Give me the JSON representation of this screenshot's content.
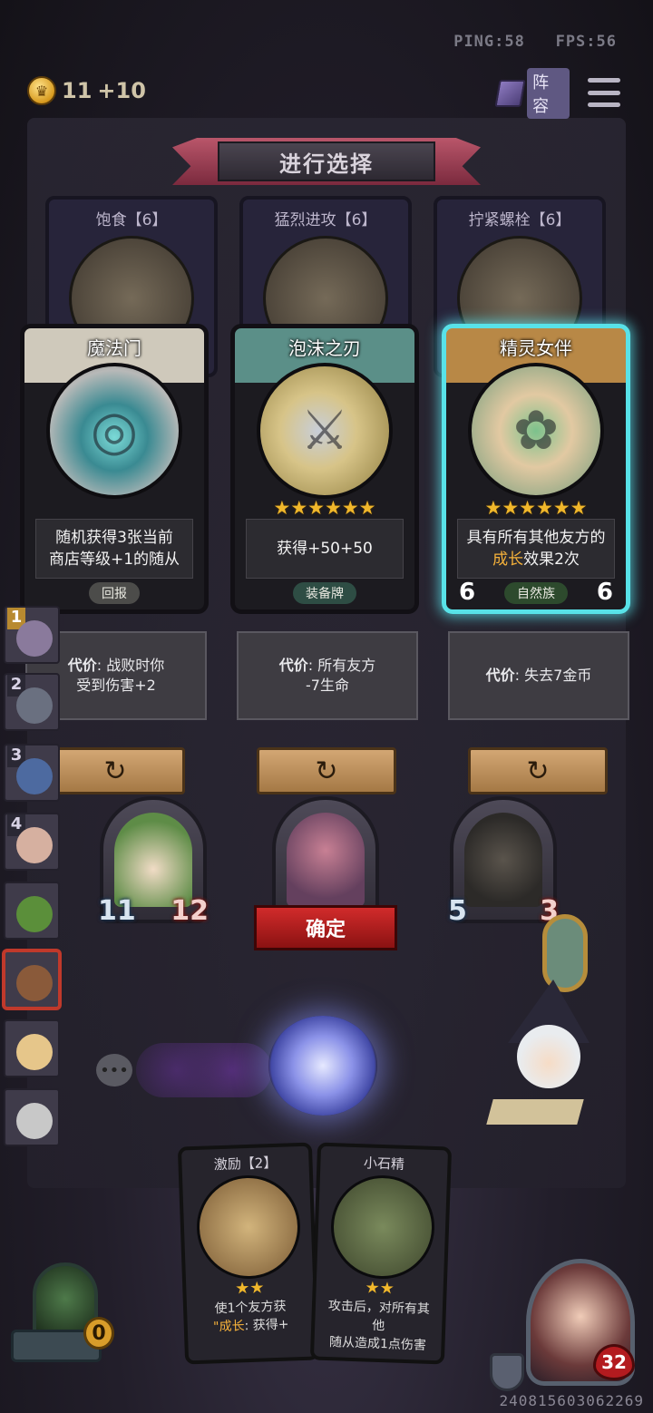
{
  "hud": {
    "ping": "PING:58",
    "fps": "FPS:56",
    "coins": "11",
    "coin_bonus": "+10",
    "lineup_label": "阵容"
  },
  "banner": {
    "title": "进行选择"
  },
  "back_cards": [
    {
      "title": "饱食【6】"
    },
    {
      "title": "猛烈进攻【6】"
    },
    {
      "title": "拧紧螺栓【6】"
    }
  ],
  "choices": [
    {
      "title": "魔法门",
      "desc_line1": "随机获得3张当前",
      "desc_line2": "商店等级+1的随从",
      "tag": "回报",
      "stars": "",
      "cost_label": "代价",
      "cost_line1": ": 战败时你",
      "cost_line2": "受到伤害+2"
    },
    {
      "title": "泡沫之刃",
      "desc_line1": "获得+50+50",
      "desc_line2": "",
      "tag": "装备牌",
      "stars": "★★★★★★",
      "cost_label": "代价",
      "cost_line1": ": 所有友方",
      "cost_line2": "-7生命"
    },
    {
      "title": "精灵女伴",
      "desc_line1": "具有所有其他友方的",
      "desc_hl": "成长",
      "desc_line2_rest": "效果2次",
      "tag": "自然族",
      "stars": "★★★★★★",
      "attack": "6",
      "health": "6",
      "cost_label": "代价",
      "cost_line1": ": 失去7金币",
      "cost_line2": ""
    }
  ],
  "shop_minions": [
    {
      "attack": "11",
      "health": "12"
    },
    {
      "attack": "",
      "health": ""
    },
    {
      "attack": "5",
      "health": "3"
    }
  ],
  "confirm_label": "确定",
  "tiers": [
    "1",
    "2",
    "3",
    "4"
  ],
  "hand": [
    {
      "title": "激励【2】",
      "stars": "★★",
      "desc_line1": "使1个友方获",
      "desc_hl": "\"成长",
      "desc_line2_rest": ": 获得+"
    },
    {
      "title": "小石精",
      "stars": "★★",
      "desc_line1": "攻击后，对所有其他",
      "desc_line2": "随从造成1点伤害"
    }
  ],
  "portal_count": "0",
  "hero_hp": "32",
  "user_id": "240815603062269",
  "icons": {
    "coin": "coin-icon",
    "lineup": "book-icon",
    "menu": "hamburger-menu-icon",
    "refresh": "refresh-arrow-icon",
    "chat": "chat-bubble-icon",
    "shield": "shield-icon"
  },
  "colors": {
    "highlight": "#f5b13a",
    "selected_glow": "#58e2e8",
    "confirm": "#d12b2b",
    "star": "#f0b72b"
  }
}
